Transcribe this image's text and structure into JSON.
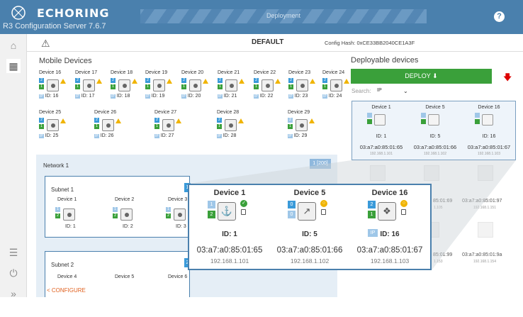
{
  "header": {
    "brand": "ECHORING",
    "subtitle": "R3 Configuration Server 7.6.7",
    "tab": "Deployment",
    "help_glyph": "?"
  },
  "toolbar": {
    "title": "DEFAULT",
    "config_hash": "Config Hash: 0xCE33BB2040CE1A3F"
  },
  "mobile": {
    "title": "Mobile Devices",
    "devices": [
      {
        "name": "Device 16",
        "id": "ID: 16"
      },
      {
        "name": "Device 17",
        "id": "ID: 17"
      },
      {
        "name": "Device 18",
        "id": "ID: 18"
      },
      {
        "name": "Device 19",
        "id": "ID: 19"
      },
      {
        "name": "Device 20",
        "id": "ID: 20"
      },
      {
        "name": "Device 21",
        "id": "ID: 21"
      },
      {
        "name": "Device 22",
        "id": "ID: 22"
      },
      {
        "name": "Device 23",
        "id": "ID: 23"
      },
      {
        "name": "Device 24",
        "id": "ID: 24"
      },
      {
        "name": "Device 25",
        "id": "ID: 25"
      },
      {
        "name": "Device 26",
        "id": "ID: 26"
      },
      {
        "name": "Device 27",
        "id": "ID: 27"
      },
      {
        "name": "Device 28",
        "id": "ID: 28"
      },
      {
        "name": "Device 29",
        "id": "ID: 29"
      }
    ]
  },
  "network": {
    "title": "Network 1",
    "badge": "1 [200]",
    "subnet1": {
      "title": "Subnet 1",
      "badge": "1",
      "devices": [
        {
          "name": "Device 1",
          "id": "ID: 1"
        },
        {
          "name": "Device 2",
          "id": "ID: 2"
        },
        {
          "name": "Device 3",
          "id": "ID: 3"
        }
      ]
    },
    "subnet2": {
      "title": "Subnet 2",
      "badge": "2",
      "devices": [
        {
          "name": "Device 4"
        },
        {
          "name": "Device 5"
        },
        {
          "name": "Device 6"
        }
      ]
    },
    "configure": "< CONFIGURE"
  },
  "deployable": {
    "title": "Deployable devices",
    "deploy_label": "DEPLOY",
    "search_label": "Search:",
    "search_value": "IP",
    "devices": [
      {
        "name": "Device 1",
        "id": "ID: 1",
        "mac": "03:a7:a0:85:01:65",
        "ip": "192.168.1.101"
      },
      {
        "name": "Device 5",
        "id": "ID: 5",
        "mac": "03:a7:a0:85:01:66",
        "ip": "192.168.1.102"
      },
      {
        "name": "Device 16",
        "id": "ID: 16",
        "mac": "03:a7:a0:85:01:67",
        "ip": "192.168.1.103"
      }
    ],
    "background_rows": [
      {
        "mac_a": "85:01:69",
        "ip_a": "1.105",
        "mac_b": "03:a7:a0:85:01:97",
        "ip_b": "192.168.1.151"
      },
      {
        "mac_a": "85:01:99",
        "ip_a": "1.153",
        "mac_b": "03:a7:a0:85:01:9a",
        "ip_b": "192.168.1.154"
      }
    ]
  },
  "icons": {
    "logo": "echoring-logo-icon",
    "home": "home-icon",
    "devices": "devices-icon",
    "menu": "menu-icon",
    "power": "power-icon",
    "collapse": "double-chevron-right-icon",
    "warning": "warning-icon",
    "deploy": "download-arrow-icon"
  },
  "colors": {
    "header": "#4a80ad",
    "deploy": "#3aa03a",
    "accent_blue": "#3a9ad9",
    "warning": "#f0b400",
    "configure": "#e0601e"
  }
}
